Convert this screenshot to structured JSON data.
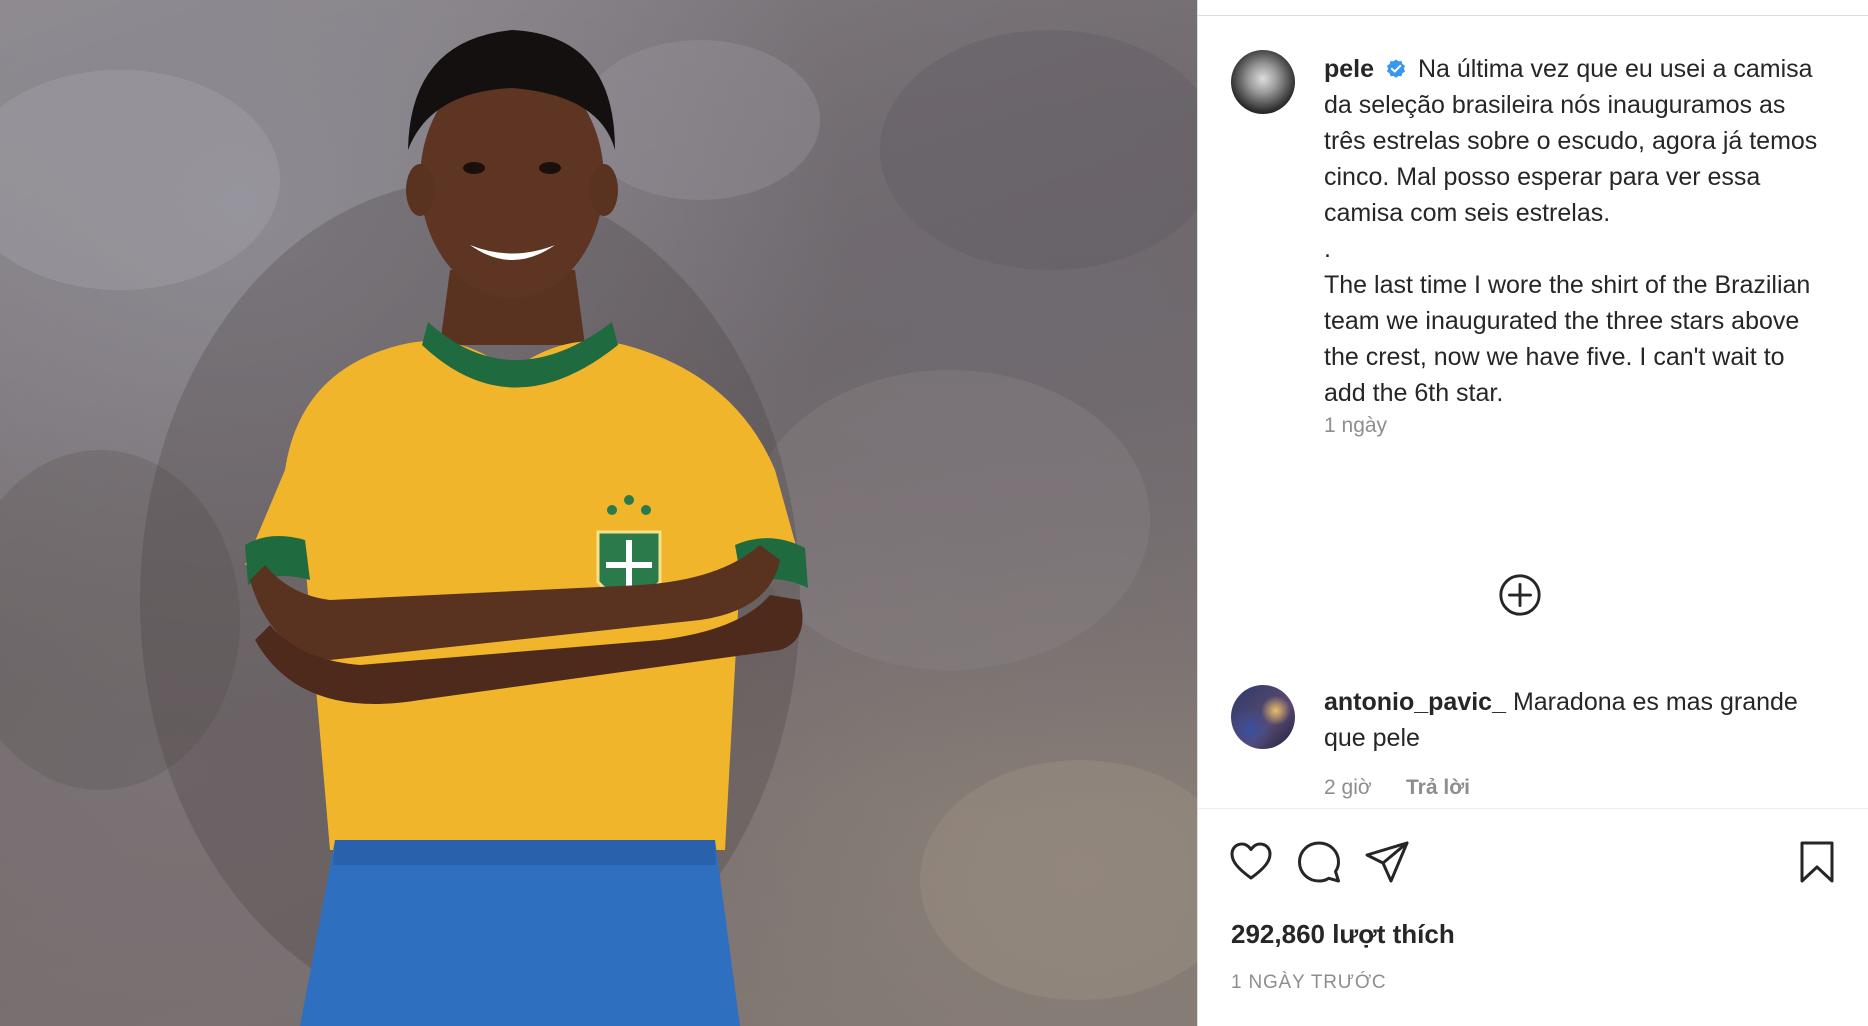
{
  "post": {
    "author": "pele",
    "caption_pt": "Na última vez que eu usei a camisa da seleção brasileira nós inauguramos as três estrelas sobre o escudo, agora já temos cinco. Mal posso esperar para ver essa camisa com seis estrelas.",
    "caption_sep": ".",
    "caption_en": "The last time I wore the shirt of the Brazilian team we inaugurated the three stars above the crest, now we have five. I can't wait to add the 6th star.",
    "caption_time": "1 ngày",
    "likes": "292,860 lượt thích",
    "date": "1 NGÀY TRƯỚC"
  },
  "comments": [
    {
      "author": "antonio_pavic_",
      "text": "Maradona es mas grande que pele",
      "time": "2 giờ",
      "reply_label": "Trả lời"
    }
  ],
  "icons": {
    "verified": "verified-badge-icon",
    "load_more": "plus-circle-icon",
    "like": "heart-icon",
    "comment": "comment-bubble-icon",
    "share": "paper-plane-icon",
    "save": "bookmark-icon"
  },
  "colors": {
    "verified_blue": "#3897f0",
    "text_primary": "#262626",
    "text_secondary": "#8e8e8e",
    "border": "#dbdbdb",
    "jersey_yellow": "#f1b52c",
    "jersey_green": "#1f6a3f",
    "shorts_blue": "#2e6fc0"
  }
}
